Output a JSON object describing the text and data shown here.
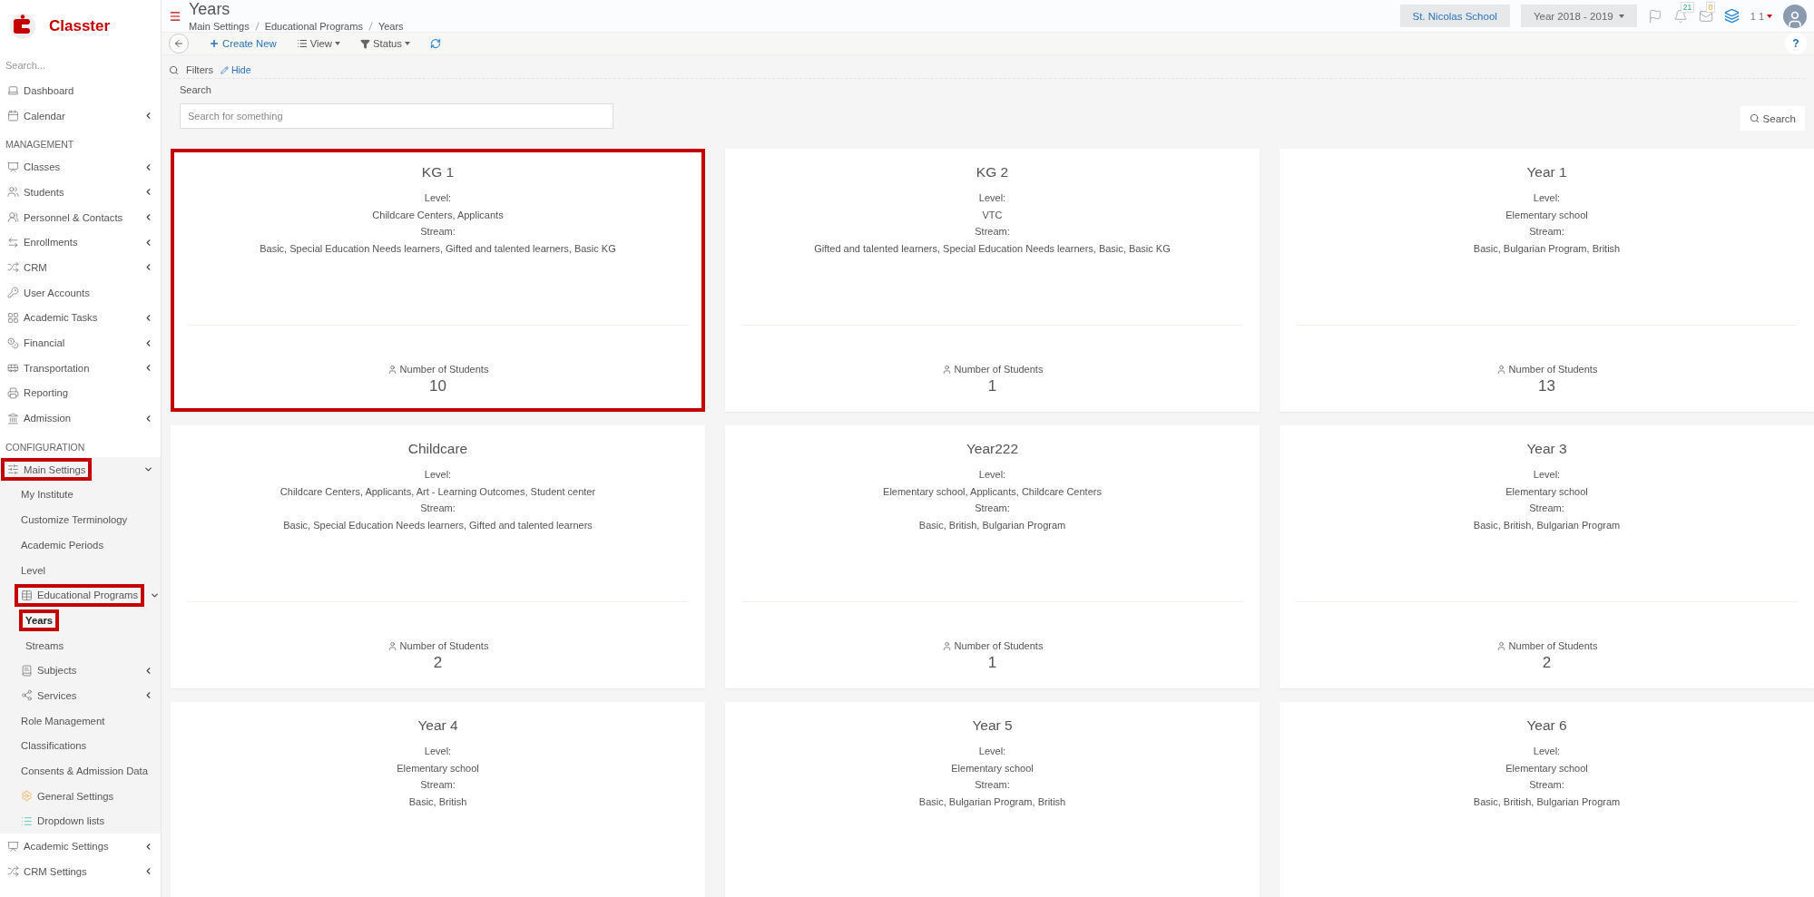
{
  "brand": {
    "name": "Classter"
  },
  "sidebar": {
    "search": {
      "placeholder": "Search..."
    },
    "items": [
      {
        "kind": "link",
        "label": "Dashboard"
      },
      {
        "kind": "link",
        "label": "Calendar",
        "expanded": false
      },
      {
        "kind": "heading",
        "label": "MANAGEMENT"
      },
      {
        "kind": "link",
        "label": "Classes",
        "expanded": false
      },
      {
        "kind": "link",
        "label": "Students",
        "expanded": false
      },
      {
        "kind": "link",
        "label": "Personnel & Contacts",
        "expanded": false
      },
      {
        "kind": "link",
        "label": "Enrollments",
        "expanded": false
      },
      {
        "kind": "link",
        "label": "CRM",
        "expanded": false
      },
      {
        "kind": "link",
        "label": "User Accounts"
      },
      {
        "kind": "link",
        "label": "Academic Tasks",
        "expanded": false
      },
      {
        "kind": "link",
        "label": "Financial",
        "expanded": false
      },
      {
        "kind": "link",
        "label": "Transportation",
        "expanded": false
      },
      {
        "kind": "link",
        "label": "Reporting"
      },
      {
        "kind": "link",
        "label": "Admission",
        "expanded": false
      },
      {
        "kind": "heading",
        "label": "CONFIGURATION"
      },
      {
        "kind": "link",
        "label": "Main Settings",
        "expanded": true,
        "highlighted": true,
        "children": [
          {
            "kind": "link",
            "label": "My Institute"
          },
          {
            "kind": "link",
            "label": "Customize Terminology"
          },
          {
            "kind": "link",
            "label": "Academic Periods"
          },
          {
            "kind": "link",
            "label": "Level"
          },
          {
            "kind": "link",
            "label": "Educational Programs",
            "expanded": true,
            "highlighted": true,
            "children": [
              {
                "kind": "link",
                "label": "Years",
                "selected": true,
                "highlighted": true
              },
              {
                "kind": "link",
                "label": "Streams",
                "selected": false,
                "highlighted": false
              }
            ]
          },
          {
            "kind": "link",
            "label": "Subjects",
            "expanded": false
          },
          {
            "kind": "link",
            "label": "Services",
            "expanded": false
          },
          {
            "kind": "link",
            "label": "Role Management"
          },
          {
            "kind": "link",
            "label": "Classifications"
          },
          {
            "kind": "link",
            "label": "Consents & Admission Data"
          },
          {
            "kind": "link",
            "label": "General Settings"
          },
          {
            "kind": "link",
            "label": "Dropdown lists"
          }
        ]
      },
      {
        "kind": "link",
        "label": "Academic Settings",
        "expanded": false
      },
      {
        "kind": "link",
        "label": "CRM Settings",
        "expanded": false
      }
    ]
  },
  "header": {
    "title": "Years",
    "breadcrumb": [
      "Main Settings",
      "Educational Programs",
      "Years"
    ],
    "school": "St. Nicolas School",
    "year": "Year 2018 - 2019",
    "notifications_count": "21",
    "messages_count": "0",
    "user": "1 1"
  },
  "toolbar": {
    "create": "Create New",
    "view": "View",
    "status": "Status",
    "help": "?"
  },
  "filters": {
    "title": "Filters",
    "hide": "Hide",
    "search_label": "Search",
    "placeholder": "Search for something",
    "search_button": "Search"
  },
  "cards": [
    {
      "title": "KG 1",
      "level_label": "Level:",
      "level": "Childcare Centers, Applicants",
      "stream_label": "Stream:",
      "stream": "Basic, Special Education Needs learners, Gifted and talented learners, Basic KG",
      "students_label": "Number of Students",
      "count": "10",
      "highlighted": true
    },
    {
      "title": "KG 2",
      "level_label": "Level:",
      "level": "VTC",
      "stream_label": "Stream:",
      "stream": "Gifted and talented learners, Special Education Needs learners, Basic, Basic KG",
      "students_label": "Number of Students",
      "count": "1",
      "highlighted": false
    },
    {
      "title": "Year 1",
      "level_label": "Level:",
      "level": "Elementary school",
      "stream_label": "Stream:",
      "stream": "Basic, Bulgarian Program, British",
      "students_label": "Number of Students",
      "count": "13",
      "highlighted": false
    },
    {
      "title": "Childcare",
      "level_label": "Level:",
      "level": "Childcare Centers, Applicants, Art - Learning Outcomes, Student center",
      "stream_label": "Stream:",
      "stream": "Basic, Special Education Needs learners, Gifted and talented learners",
      "students_label": "Number of Students",
      "count": "2",
      "highlighted": false
    },
    {
      "title": "Year222",
      "level_label": "Level:",
      "level": "Elementary school, Applicants, Childcare Centers",
      "stream_label": "Stream:",
      "stream": "Basic, British, Bulgarian Program",
      "students_label": "Number of Students",
      "count": "1",
      "highlighted": false
    },
    {
      "title": "Year 3",
      "level_label": "Level:",
      "level": "Elementary school",
      "stream_label": "Stream:",
      "stream": "Basic, British, Bulgarian Program",
      "students_label": "Number of Students",
      "count": "2",
      "highlighted": false
    },
    {
      "title": "Year 4",
      "level_label": "Level:",
      "level": "Elementary school",
      "stream_label": "Stream:",
      "stream": "Basic, British",
      "highlighted": false
    },
    {
      "title": "Year 5",
      "level_label": "Level:",
      "level": "Elementary school",
      "stream_label": "Stream:",
      "stream": "Basic, Bulgarian Program, British",
      "highlighted": false
    },
    {
      "title": "Year 6",
      "level_label": "Level:",
      "level": "Elementary school",
      "stream_label": "Stream:",
      "stream": "Basic, British, Bulgarian Program",
      "highlighted": false
    }
  ]
}
